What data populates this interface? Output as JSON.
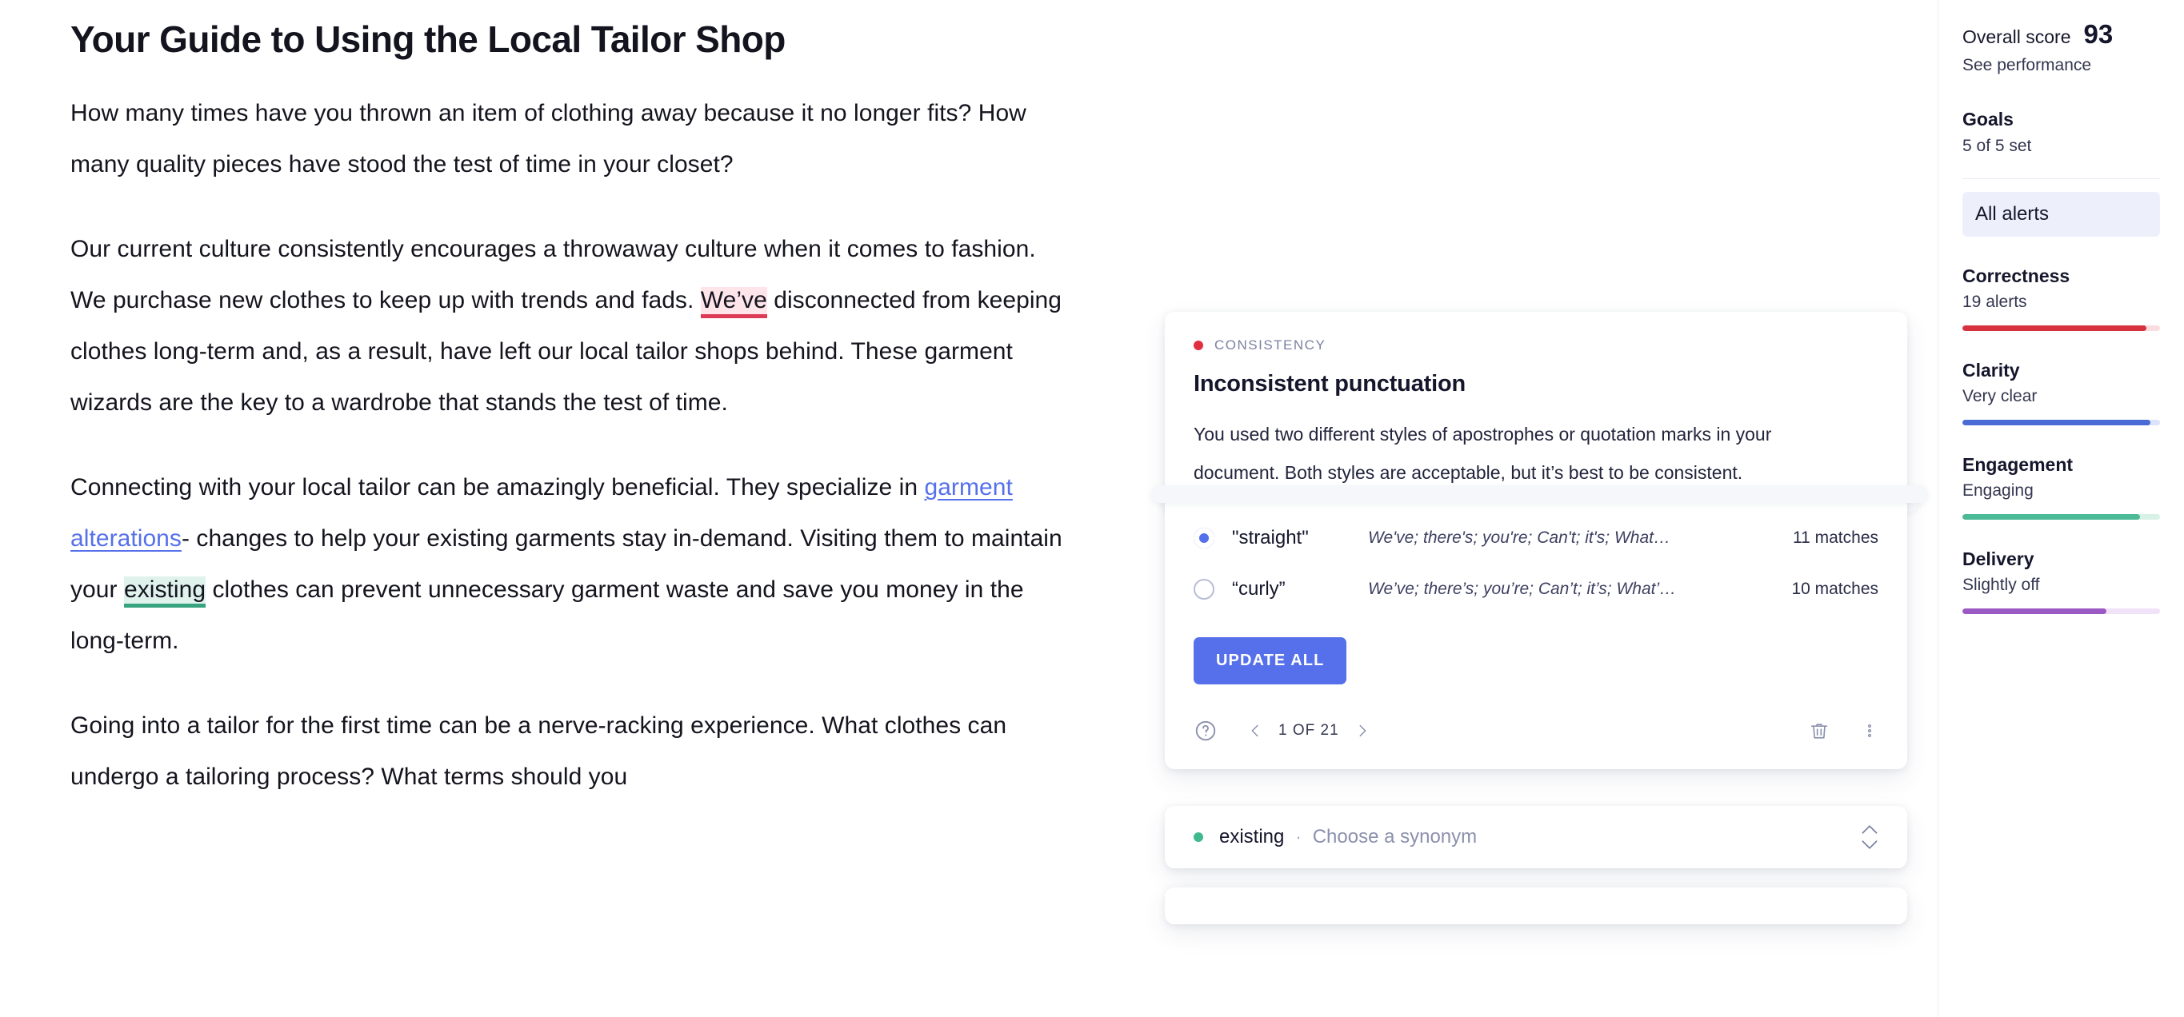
{
  "document": {
    "title": "Your Guide to Using the Local Tailor Shop",
    "paragraphs": [
      {
        "id": "p1",
        "text": "How many times have you thrown an item of clothing away because it no longer fits? How many quality pieces have stood the test of time in your closet?"
      },
      {
        "id": "p2",
        "before": "Our current culture consistently encourages a throwaway culture when it comes to fashion. We purchase new clothes to keep up with trends and fads. ",
        "highlight": "We’ve",
        "after": " disconnected from keeping clothes long-term and, as a result, have left our local tailor shops behind. These garment wizards are the key to a wardrobe that stands the test of time."
      },
      {
        "id": "p3",
        "seg1": "Connecting with your local tailor can be amazingly beneficial. They specialize in ",
        "link": "garment alterations",
        "seg2": "- changes to help your existing garments stay in-demand. Visiting them to maintain your ",
        "highlight": "existing",
        "seg3": " clothes can prevent unnecessary garment waste and save you money in the long-term."
      },
      {
        "id": "p4",
        "text": "Going into a tailor for the first time can be a nerve-racking experience. What clothes can undergo a tailoring process? What terms should you"
      }
    ]
  },
  "suggestion_card": {
    "category": "CONSISTENCY",
    "category_dot_color": "#e02f3f",
    "title": "Inconsistent punctuation",
    "description": "You used two different styles of apostrophes or quotation marks in your document. Both styles are acceptable, but it’s best to be consistent.",
    "options": [
      {
        "name": "\"straight\"",
        "examples": "We've; there's; you're; Can't; it's; What…",
        "matches": "11 matches",
        "selected": true
      },
      {
        "name": "“curly”",
        "examples": "We’ve; there’s; you’re; Can’t; it’s; What’…",
        "matches": "10 matches",
        "selected": false
      }
    ],
    "update_button": "UPDATE ALL",
    "accent_color": "#5570ea",
    "footer": {
      "help_icon": "question-circle-icon",
      "prev_icon": "chevron-left-icon",
      "pagination": "1 OF 21",
      "next_icon": "chevron-right-icon",
      "delete_icon": "trash-icon",
      "more_icon": "more-vertical-icon"
    }
  },
  "synonym_card": {
    "dot_color": "#3fba8e",
    "word": "existing",
    "separator": "·",
    "placeholder": "Choose a synonym",
    "stepper_up_icon": "chevron-up-icon",
    "stepper_down_icon": "chevron-down-icon"
  },
  "sidebar": {
    "overall_score_label": "Overall score",
    "overall_score_value": "93",
    "see_performance": "See performance",
    "goals_title": "Goals",
    "goals_sub": "5 of 5 set",
    "all_alerts": "All alerts",
    "metrics": [
      {
        "name": "Correctness",
        "sub": "19 alerts",
        "fill_pct": 93,
        "color": "#d6333f",
        "track_color": "#fadde0"
      },
      {
        "name": "Clarity",
        "sub": "Very clear",
        "fill_pct": 95,
        "color": "#4a6ad4",
        "track_color": "#dbe3f8"
      },
      {
        "name": "Engagement",
        "sub": "Engaging",
        "fill_pct": 90,
        "color": "#4cba96",
        "track_color": "#d9f2e8"
      },
      {
        "name": "Delivery",
        "sub": "Slightly off",
        "fill_pct": 73,
        "color": "#9b59c4",
        "track_color": "#f0e2f8"
      }
    ]
  }
}
